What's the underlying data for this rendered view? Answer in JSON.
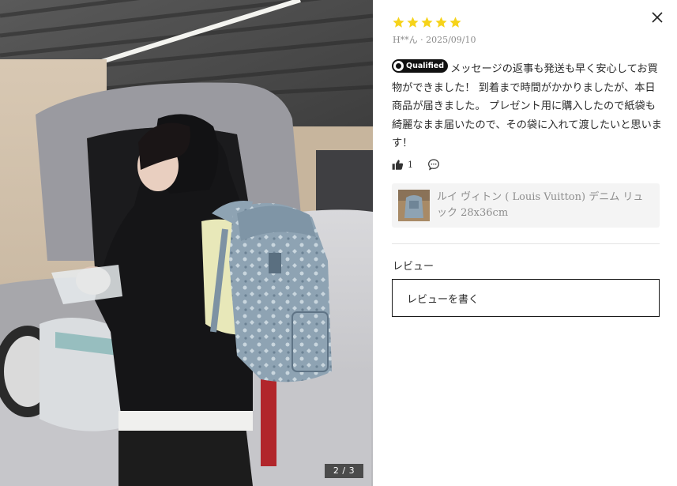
{
  "gallery": {
    "counter": "2 / 3"
  },
  "review": {
    "rating": 5,
    "star_color": "#F6D31A",
    "author_date": "H**ん · 2025/09/10",
    "badge_label": "Qualified",
    "text": "メッセージの返事も発送も早く安心してお買物ができました！ 到着まで時間がかかりましたが、本日商品が届きました。 プレゼント用に購入したので紙袋も綺麗なまま届いたので、その袋に入れて渡したいと思います！",
    "like_count": "1"
  },
  "product": {
    "name": "ルイ ヴィトン ( Louis Vuitton) デニム リュック 28x36cm"
  },
  "reviews_section": {
    "title": "レビュー",
    "write_button": "レビューを書く"
  },
  "icons": {
    "close": "close-icon",
    "like": "thumbs-up-icon",
    "comment": "comment-icon",
    "badge": "qualified-badge-icon"
  }
}
